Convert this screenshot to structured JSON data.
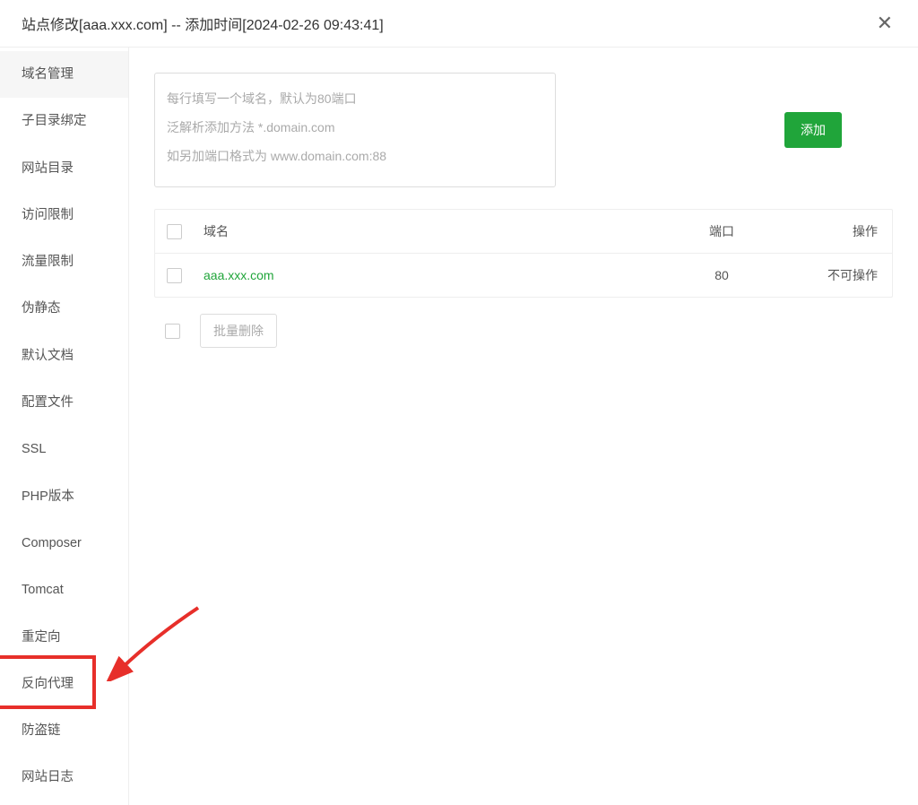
{
  "header": {
    "title": "站点修改[aaa.xxx.com] -- 添加时间[2024-02-26 09:43:41]"
  },
  "sidebar": {
    "items": [
      {
        "label": "域名管理",
        "active": true
      },
      {
        "label": "子目录绑定"
      },
      {
        "label": "网站目录"
      },
      {
        "label": "访问限制"
      },
      {
        "label": "流量限制"
      },
      {
        "label": "伪静态"
      },
      {
        "label": "默认文档"
      },
      {
        "label": "配置文件"
      },
      {
        "label": "SSL"
      },
      {
        "label": "PHP版本"
      },
      {
        "label": "Composer"
      },
      {
        "label": "Tomcat"
      },
      {
        "label": "重定向"
      },
      {
        "label": "反向代理"
      },
      {
        "label": "防盗链"
      },
      {
        "label": "网站日志"
      }
    ]
  },
  "main": {
    "textarea_placeholder": "每行填写一个域名，默认为80端口\n泛解析添加方法 *.domain.com\n如另加端口格式为 www.domain.com:88",
    "add_button": "添加",
    "table": {
      "head": {
        "domain": "域名",
        "port": "端口",
        "action": "操作"
      },
      "rows": [
        {
          "domain": "aaa.xxx.com",
          "port": "80",
          "action": "不可操作"
        }
      ]
    },
    "batch_delete": "批量删除"
  },
  "annotation": {
    "highlight_target_index": 13,
    "arrow_color": "#e72f2a"
  }
}
